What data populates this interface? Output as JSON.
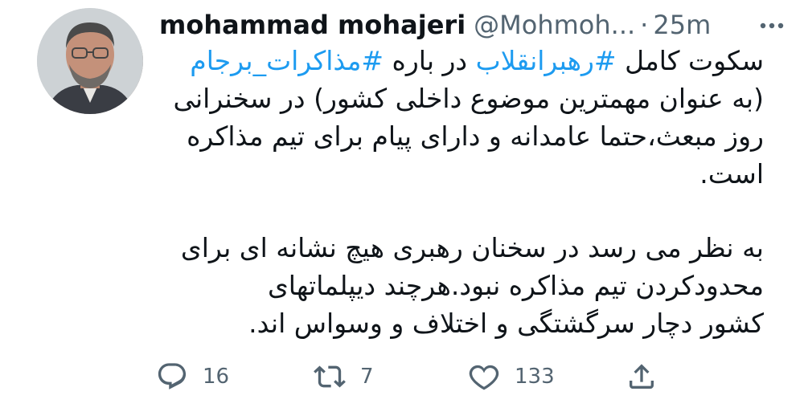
{
  "tweet": {
    "display_name": "mohammad mohajeri",
    "handle": "@Mohmoh...",
    "separator": "·",
    "time": "25m",
    "body": {
      "p1_line1_a": "سکوت کامل ",
      "p1_hashtag1": "#رهبرانقلاب",
      "p1_line1_b": " در باره ",
      "p1_hashtag2": "#مذاکرات_برجام",
      "p1_line2": "(به عنوان مهمترین موضوع داخلی کشور) در سخنرانی",
      "p1_line3": "روز مبعث،حتما عامدانه و دارای پیام برای تیم مذاکره",
      "p1_line4": "است.",
      "p2_line1": "به نظر می رسد در سخنان رهبری هیچ نشانه ای برای",
      "p2_line2": "محدودکردن تیم مذاکره نبود.هرچند دیپلماتهای",
      "p2_line3": "کشور دچار سرگشتگی و اختلاف و وسواس اند."
    },
    "actions": {
      "reply_count": "16",
      "retweet_count": "7",
      "like_count": "133"
    }
  },
  "colors": {
    "hashtag": "#1d9bf0",
    "muted": "#536471",
    "text": "#0f1419"
  }
}
